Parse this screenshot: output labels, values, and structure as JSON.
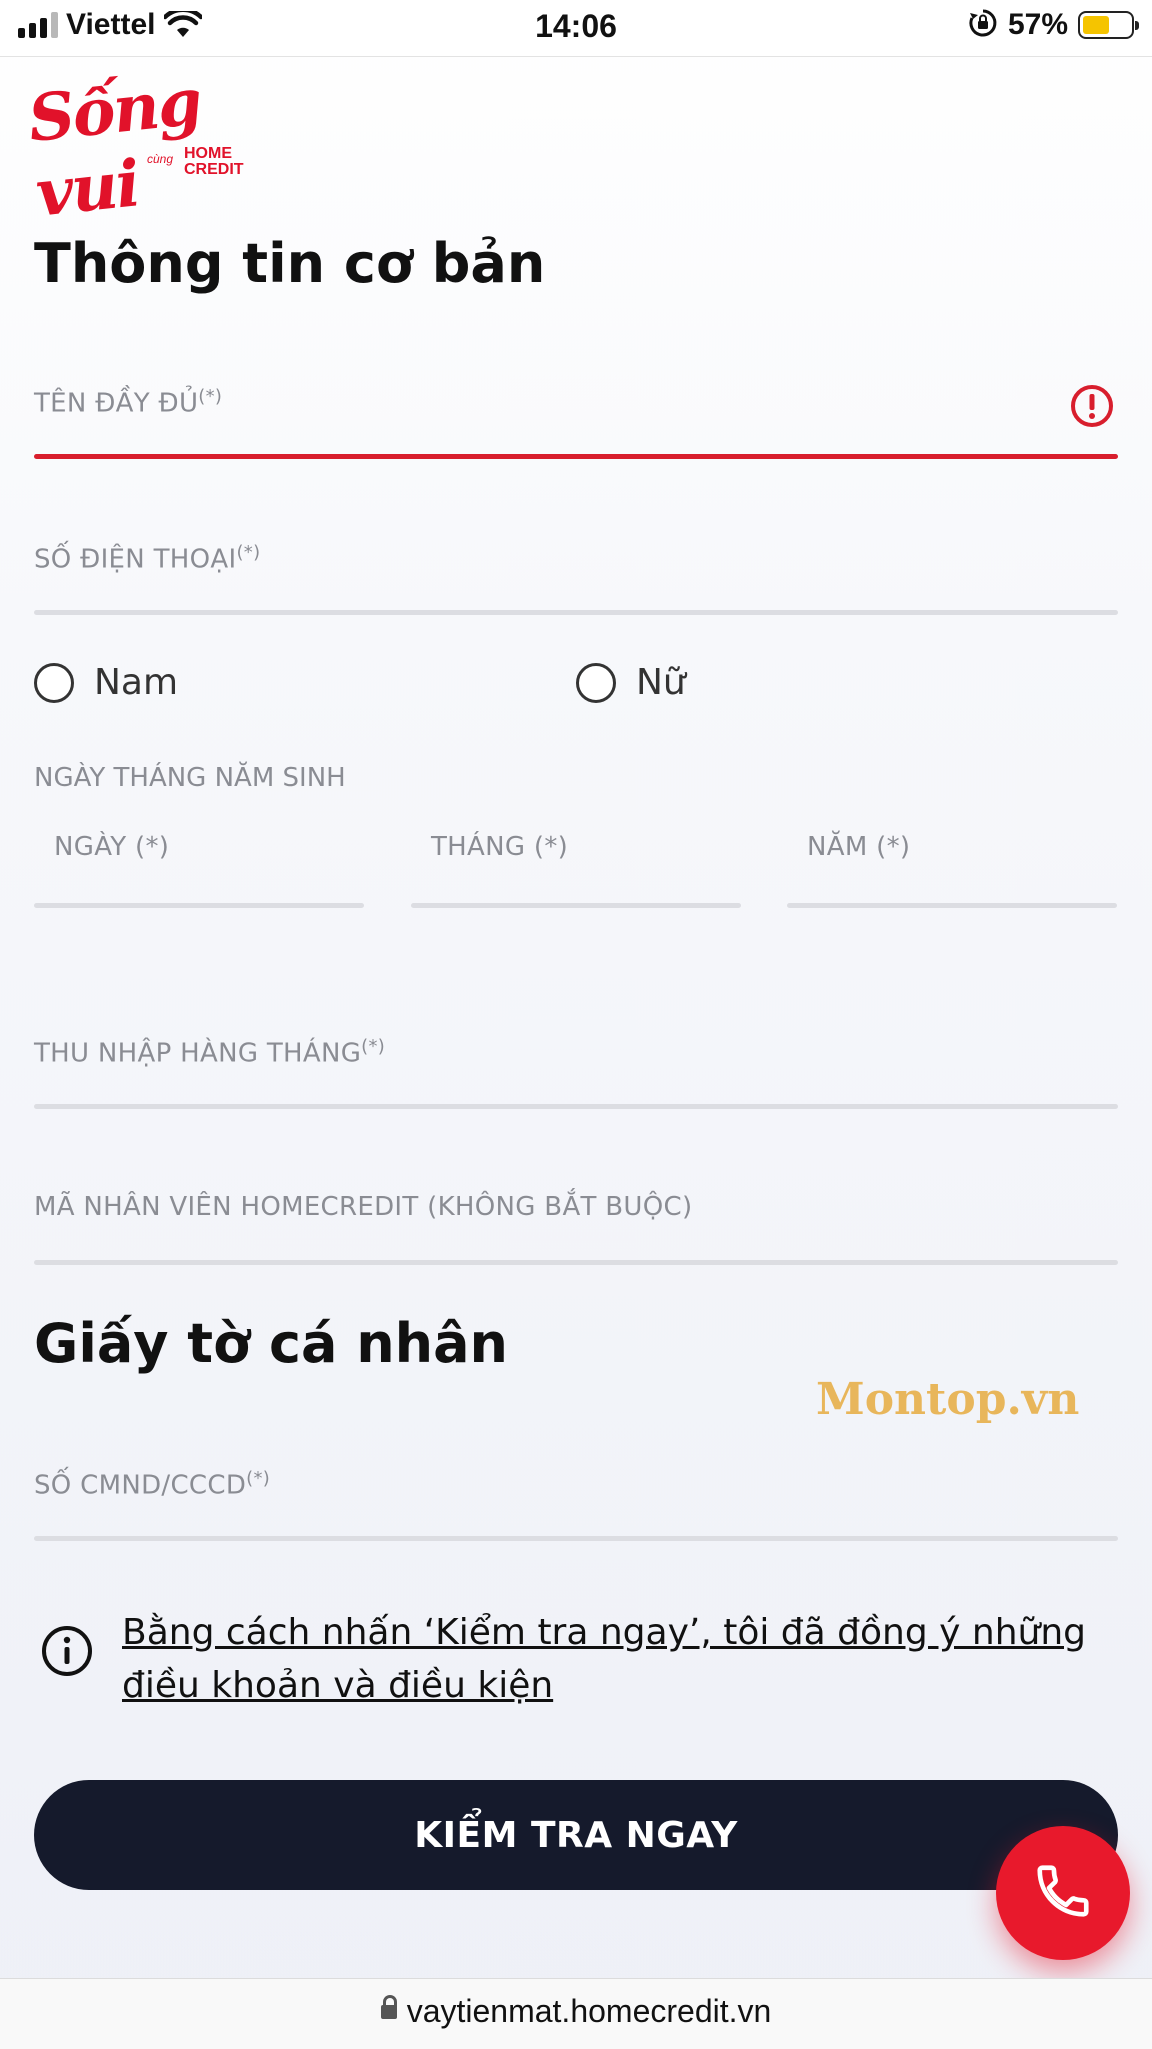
{
  "status_bar": {
    "carrier": "Viettel",
    "time": "14:06",
    "battery_percent": "57%",
    "battery_level": 0.57,
    "icons": [
      "signal-icon",
      "wifi-icon",
      "rotation-lock-icon",
      "battery-icon"
    ]
  },
  "logo": {
    "script": "Sống vui",
    "sub": "cùng",
    "brand_line1": "HOME",
    "brand_line2": "CREDIT"
  },
  "sections": {
    "basic_info_title": "Thông tin cơ bản",
    "documents_title": "Giấy tờ cá nhân"
  },
  "fields": {
    "full_name": {
      "label": "TÊN ĐẦY ĐỦ",
      "required_mark": "(*)",
      "state": "error"
    },
    "phone": {
      "label": "SỐ ĐIỆN THOẠI",
      "required_mark": "(*)"
    },
    "income": {
      "label": "THU NHẬP HÀNG THÁNG",
      "required_mark": "(*)"
    },
    "employee_code": {
      "label": "MÃ NHÂN VIÊN HOMECREDIT (KHÔNG BẮT BUỘC)"
    },
    "id_number": {
      "label": "SỐ CMND/CCCD",
      "required_mark": "(*)"
    }
  },
  "gender": {
    "options": [
      "Nam",
      "Nữ"
    ]
  },
  "dob": {
    "caption": "NGÀY THÁNG NĂM SINH",
    "day": "NGÀY (*)",
    "month": "THÁNG (*)",
    "year": "NĂM (*)"
  },
  "consent": {
    "text": "Bằng cách nhấn ‘Kiểm tra ngay’, tôi đã đồng ý những điều khoản và điều kiện"
  },
  "cta": {
    "label": "KIỂM TRA NGAY"
  },
  "watermark": "Montop.vn",
  "browser": {
    "url": "vaytienmat.homecredit.vn"
  },
  "colors": {
    "brand_red": "#e1122a",
    "error_red": "#d81e2d",
    "cta_bg": "#151a2c",
    "fab_red": "#e8192c",
    "label_gray": "#8a8c93"
  }
}
